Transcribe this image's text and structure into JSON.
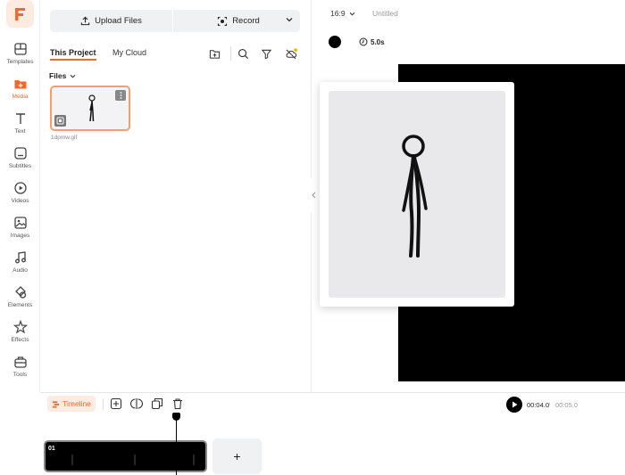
{
  "nav": {
    "items": [
      {
        "label": "Templates",
        "icon": "templates-icon"
      },
      {
        "label": "Media",
        "icon": "media-icon",
        "active": true
      },
      {
        "label": "Text",
        "icon": "text-icon"
      },
      {
        "label": "Subtitles",
        "icon": "subtitles-icon"
      },
      {
        "label": "Videos",
        "icon": "videos-icon"
      },
      {
        "label": "Images",
        "icon": "images-icon"
      },
      {
        "label": "Audio",
        "icon": "audio-icon"
      },
      {
        "label": "Elements",
        "icon": "elements-icon"
      },
      {
        "label": "Effects",
        "icon": "effects-icon"
      },
      {
        "label": "Tools",
        "icon": "tools-icon"
      }
    ]
  },
  "panel": {
    "upload_label": "Upload Files",
    "record_label": "Record",
    "tabs": [
      {
        "label": "This Project",
        "active": true
      },
      {
        "label": "My Cloud",
        "active": false
      }
    ],
    "files_label": "Files",
    "file": {
      "name": "1dpmw.gif"
    }
  },
  "editor": {
    "aspect_ratio": "16:9",
    "title": "Untitled",
    "background_color": "#000000",
    "duration": "5.0s"
  },
  "timeline": {
    "label": "Timeline",
    "current_time": "00:04.0",
    "separator": "/",
    "total_time": "00:05.0",
    "clip_label": "01",
    "add_label": "+"
  },
  "colors": {
    "accent": "#f06a2b",
    "accent_light": "#fdebe1"
  }
}
